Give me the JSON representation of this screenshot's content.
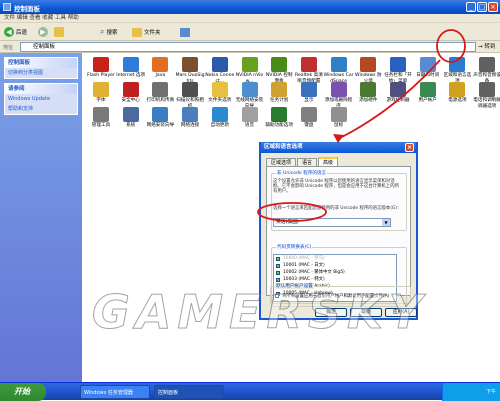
{
  "window": {
    "title": "控制面板",
    "menu": "文件 编辑 查看 收藏 工具 帮助"
  },
  "toolbar": {
    "back": "后退",
    "search": "搜索",
    "folders": "文件夹"
  },
  "address": {
    "label": "地址",
    "value": "控制面板",
    "go": "转到"
  },
  "sidebar": {
    "pane1": {
      "title": "控制面板",
      "items": [
        "切换到分类视图"
      ]
    },
    "pane2": {
      "title": "请参阅",
      "items": [
        "Windows Update",
        "帮助和支持"
      ]
    }
  },
  "icons": [
    {
      "label": "Flash Player",
      "color": "#c8221a"
    },
    {
      "label": "Internet 选项",
      "color": "#2f7bd8"
    },
    {
      "label": "Java",
      "color": "#e07020"
    },
    {
      "label": "Mars DuoSights",
      "color": "#7a5030"
    },
    {
      "label": "Nokia Connect...",
      "color": "#2a5aa8"
    },
    {
      "label": "NVIDIA nView...",
      "color": "#6aa020"
    },
    {
      "label": "NVIDIA 控制面板",
      "color": "#4a8a18"
    },
    {
      "label": "Realtek 高清晰音频配置",
      "color": "#c03030"
    },
    {
      "label": "Windows CardSpace",
      "color": "#3080c8"
    },
    {
      "label": "Windows 防火墙",
      "color": "#b04a20"
    },
    {
      "label": "任务栏和「开始」菜单",
      "color": "#2a60c0"
    },
    {
      "label": "日期和时间",
      "color": "#5a8ad0"
    },
    {
      "label": "区域和语言选项",
      "color": "#2a7ad0"
    },
    {
      "label": "声音和音频设备",
      "color": "#606060"
    },
    {
      "label": "字体",
      "color": "#e0b030"
    },
    {
      "label": "安全中心",
      "color": "#c02020"
    },
    {
      "label": "打印机和传真",
      "color": "#707070"
    },
    {
      "label": "扫描仪和照相机",
      "color": "#505050"
    },
    {
      "label": "文件夹选项",
      "color": "#e8c040"
    },
    {
      "label": "无线网络安装向导",
      "color": "#4a90d0"
    },
    {
      "label": "任务计划",
      "color": "#d0a030"
    },
    {
      "label": "显示",
      "color": "#3a70c0"
    },
    {
      "label": "添加或删除程序",
      "color": "#7a50b0"
    },
    {
      "label": "添加硬件",
      "color": "#4a7a30"
    },
    {
      "label": "游戏控制器",
      "color": "#505080"
    },
    {
      "label": "用户帐户",
      "color": "#3a8a50"
    },
    {
      "label": "电源选项",
      "color": "#d0a020"
    },
    {
      "label": "电话和调制解调器选项",
      "color": "#606060"
    },
    {
      "label": "管理工具",
      "color": "#7a7a7a"
    },
    {
      "label": "系统",
      "color": "#4a6aa0"
    },
    {
      "label": "网络安装向导",
      "color": "#3a80c0"
    },
    {
      "label": "网络连接",
      "color": "#4a80c0"
    },
    {
      "label": "自动更新",
      "color": "#2a8ad0"
    },
    {
      "label": "语音",
      "color": "#a0a0a0"
    },
    {
      "label": "辅助功能选项",
      "color": "#2a7a30"
    },
    {
      "label": "键盘",
      "color": "#808080"
    },
    {
      "label": "鼠标",
      "color": "#909090"
    }
  ],
  "dialog": {
    "title": "区域和语言选项",
    "close": "×",
    "tabs": [
      "区域选项",
      "语言",
      "高级"
    ],
    "group1": {
      "title": "非 Unicode 程序的语言",
      "desc": "这个设置允许非 Unicode 程序以您使用的语言显示菜单和对话框。它不会影响 Unicode 程序，但是会应用于这台计算机上的所有用户。",
      "prompt": "选择一个语言来匹配您想使用的非 Unicode 程序的语言版本(G)：",
      "value": "英语(美国)"
    },
    "group2": {
      "title": "代码页转换表(C)",
      "items": [
        "10000 (MAC - 罗马)",
        "10001 (MAC - 日文)",
        "10002 (MAC - 繁体中文 Big5)",
        "10003 (MAC - 韩文)",
        "10004 (MAC - Arabic)",
        "10005 (MAC - Hebrew)"
      ]
    },
    "group3": {
      "title": "默认用户帐户设置",
      "check": "将所有设置应用于当前用户帐户和默认用户配置文件(A)"
    },
    "buttons": [
      "确定",
      "取消",
      "应用(A)"
    ]
  },
  "taskbar": {
    "start": "开始",
    "tasks": [
      "Windows 任务管理器",
      "控制面板"
    ],
    "clock": "下午"
  },
  "watermark": "GAMERSKY"
}
